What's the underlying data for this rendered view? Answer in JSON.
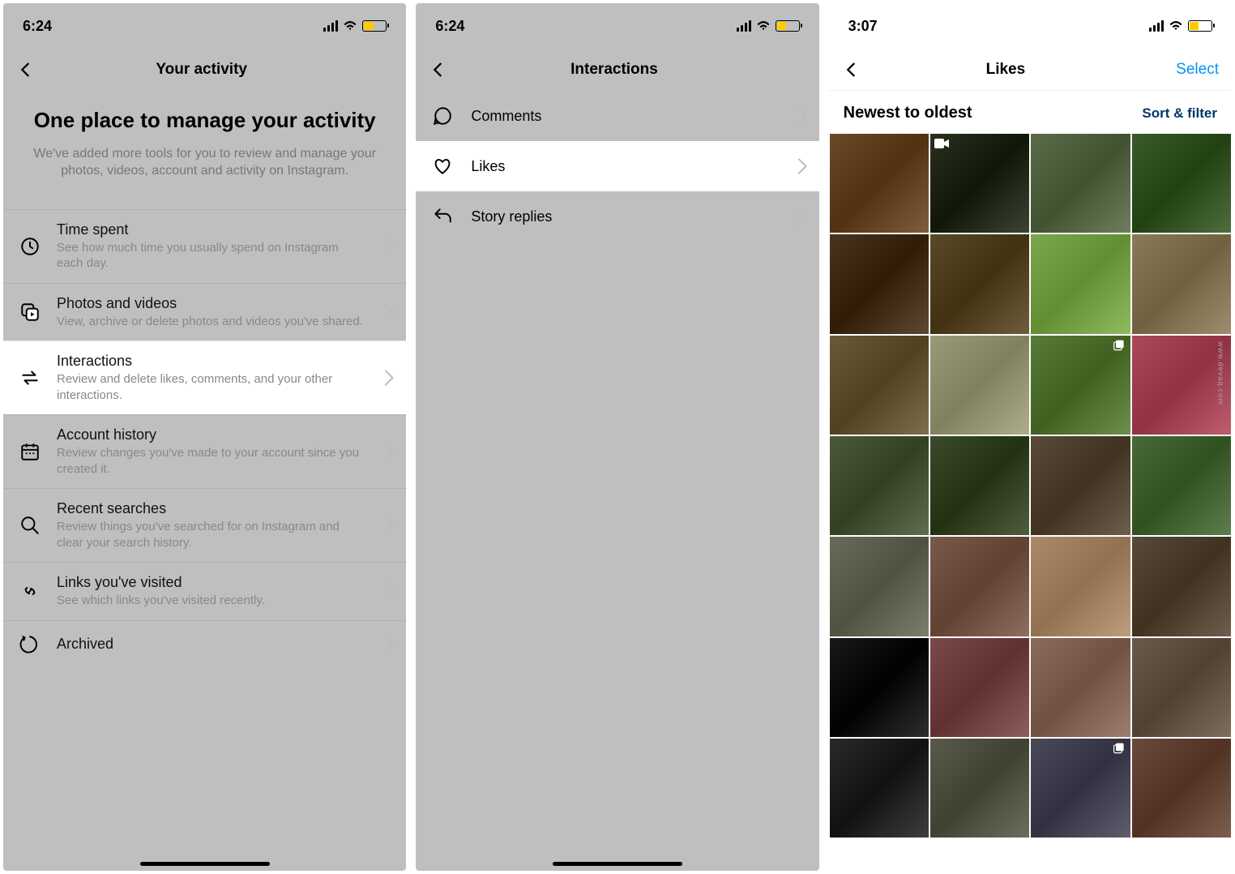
{
  "panel1": {
    "time": "6:24",
    "nav_title": "Your activity",
    "hero_title": "One place to manage your activity",
    "hero_sub": "We've added more tools for you to review and manage your photos, videos, account and activity on Instagram.",
    "rows": [
      {
        "icon": "clock",
        "title": "Time spent",
        "sub": "See how much time you usually spend on Instagram each day."
      },
      {
        "icon": "media",
        "title": "Photos and videos",
        "sub": "View, archive or delete photos and videos you've shared."
      },
      {
        "icon": "swap",
        "title": "Interactions",
        "sub": "Review and delete likes, comments, and your other interactions.",
        "highlight": true
      },
      {
        "icon": "calendar",
        "title": "Account history",
        "sub": "Review changes you've made to your account since you created it."
      },
      {
        "icon": "search",
        "title": "Recent searches",
        "sub": "Review things you've searched for on Instagram and clear your search history."
      },
      {
        "icon": "link",
        "title": "Links you've visited",
        "sub": "See which links you've visited recently."
      },
      {
        "icon": "archive",
        "title": "Archived",
        "sub": ""
      }
    ]
  },
  "panel2": {
    "time": "6:24",
    "nav_title": "Interactions",
    "rows": [
      {
        "icon": "comment",
        "label": "Comments"
      },
      {
        "icon": "heart",
        "label": "Likes",
        "highlight": true
      },
      {
        "icon": "reply",
        "label": "Story replies"
      }
    ]
  },
  "panel3": {
    "time": "3:07",
    "nav_title": "Likes",
    "nav_action": "Select",
    "sort_label": "Newest to oldest",
    "sort_filter": "Sort & filter",
    "tiles": [
      {
        "c": "#6b4a2a"
      },
      {
        "c": "#2a3020",
        "badge": "video"
      },
      {
        "c": "#5a6b4a"
      },
      {
        "c": "#3a5a2a"
      },
      {
        "c": "#4a3520"
      },
      {
        "c": "#5a4a2a"
      },
      {
        "c": "#7aa84a"
      },
      {
        "c": "#8a7a5a"
      },
      {
        "c": "#6a5a3a"
      },
      {
        "c": "#9a9a7a"
      },
      {
        "c": "#5a7a3a",
        "badge": "multi"
      },
      {
        "c": "#aa4a5a"
      },
      {
        "c": "#4a5a3a"
      },
      {
        "c": "#3a4a2a"
      },
      {
        "c": "#5a4a3a"
      },
      {
        "c": "#4a6a3a"
      },
      {
        "c": "#6a6a5a"
      },
      {
        "c": "#7a5a4a"
      },
      {
        "c": "#aa8a6a"
      },
      {
        "c": "#5a4a3a"
      },
      {
        "c": "#1a1a1a"
      },
      {
        "c": "#7a4a4a"
      },
      {
        "c": "#8a6a5a"
      },
      {
        "c": "#6a5a4a"
      },
      {
        "c": "#2a2a2a"
      },
      {
        "c": "#5a5a4a"
      },
      {
        "c": "#4a4a5a",
        "badge": "multi"
      },
      {
        "c": "#6a4a3a"
      }
    ]
  },
  "watermark": "www.devaq.com"
}
